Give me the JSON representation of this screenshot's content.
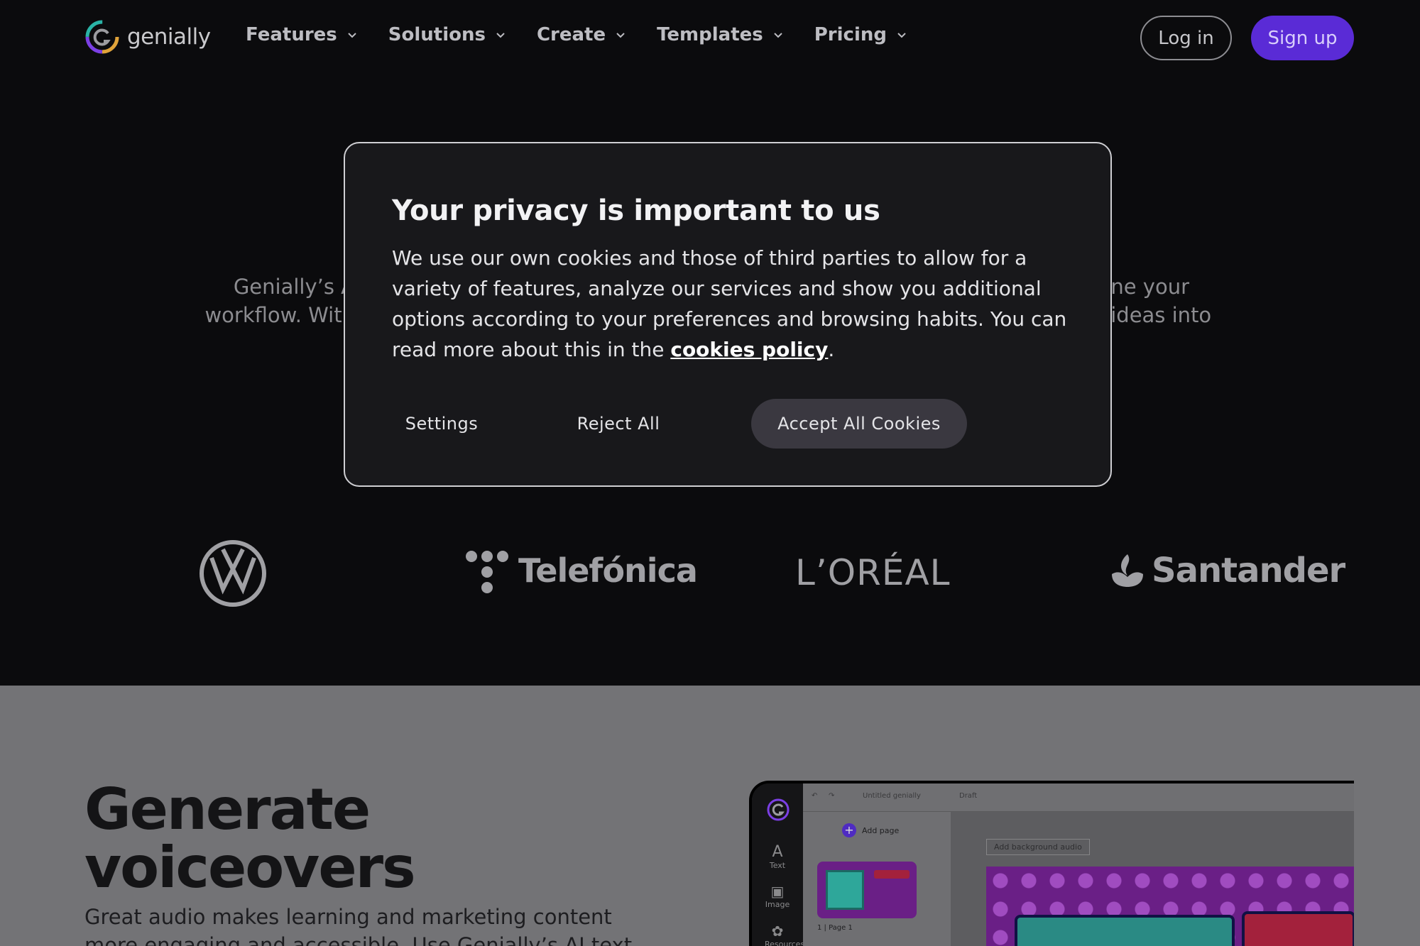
{
  "nav": {
    "logo_text": "genially",
    "items": [
      {
        "label": "Features"
      },
      {
        "label": "Solutions"
      },
      {
        "label": "Create"
      },
      {
        "label": "Templates"
      },
      {
        "label": "Pricing"
      }
    ],
    "login_label": "Log in",
    "signup_label": "Sign up"
  },
  "hero": {
    "left_line1": "Genially’s A",
    "left_line2": "workflow. With",
    "right_line1": "mline your",
    "right_line2": "ve ideas into"
  },
  "brands": {
    "telefonica": "Telefónica",
    "loreal": "L’ORÉAL",
    "santander": "Santander"
  },
  "section": {
    "title_line1": "Generate",
    "title_line2": "voiceovers",
    "body": "Great audio makes learning and marketing content more engaging and accessible. Use Genially’s AI text"
  },
  "mockup": {
    "sidebar_text": "Text",
    "sidebar_image": "Image",
    "sidebar_resources": "Resources",
    "doc_name": "Untitled genially",
    "draft": "Draft",
    "add_page": "Add page",
    "page_label": "1 | Page 1",
    "add_audio": "Add background audio"
  },
  "cookie_modal": {
    "title": "Your privacy is important to us",
    "body_before_link": "We use our own cookies and those of third parties to allow for a variety of features, analyze our services and show you additional options according to your preferences and browsing habits. You can read more about this in the ",
    "link_text": "cookies policy",
    "body_after_link": ".",
    "settings_label": "Settings",
    "reject_label": "Reject All",
    "accept_label": "Accept All Cookies"
  },
  "colors": {
    "background": "#0b0b0d",
    "brand_purple": "#5a2bd6",
    "modal_bg": "#18181b",
    "accept_button": "#3a3840"
  }
}
